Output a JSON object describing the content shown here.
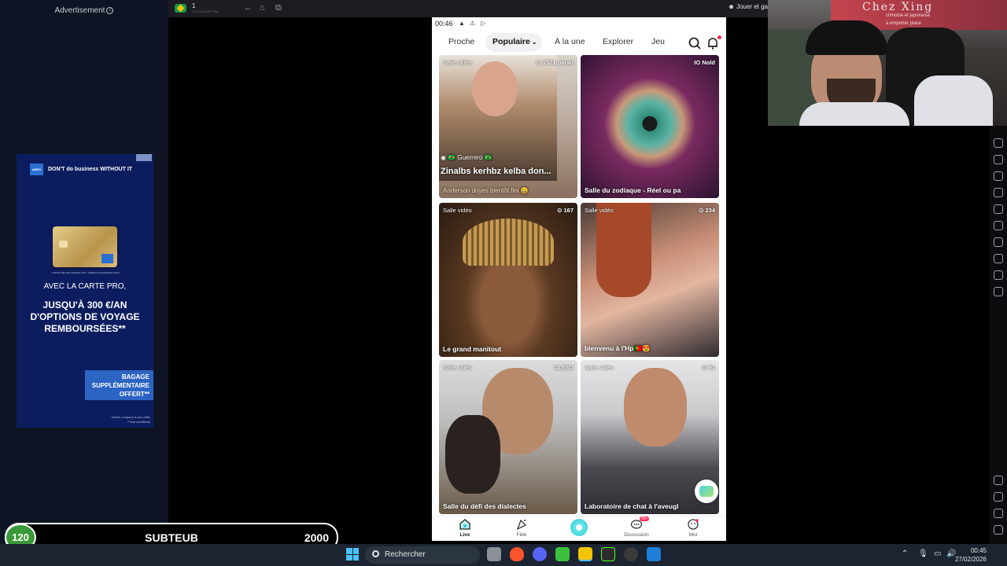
{
  "ad": {
    "label": "Advertisement",
    "brand_tagline": "DON'T do business WITHOUT IT",
    "card_fineprint": "CARTE PRO AIR FRANCE KLM - AMERICAN EXPRESS GOLD",
    "headline": "AVEC LA CARTE PRO,",
    "offer": "JUSQU'À 300 €/AN D'OPTIONS DE VOYAGE REMBOURSÉES**",
    "badge": "BAGAGE SUPPLÉMENTAIRE OFFERT**",
    "legal_1": "*Amex, toujours à vos côtés",
    "legal_2": "**Voir conditions"
  },
  "browser": {
    "tab_title": "1",
    "tab_subtitle": "4.22.110.1037.P44",
    "right_text": "Jouer et ga"
  },
  "webcam": {
    "sign_text": "Chez Xing",
    "sign_sub_1": "chinoise et japonaise",
    "sign_sub_2": "à emporter    place"
  },
  "phone": {
    "status_time": "00:46",
    "tabs": [
      {
        "label": "Proche",
        "active": false
      },
      {
        "label": "Populaire",
        "active": true
      },
      {
        "label": "À la une",
        "active": false
      },
      {
        "label": "Explorer",
        "active": false
      },
      {
        "label": "Jeu",
        "active": false
      }
    ],
    "cards": [
      {
        "badge": "Salle vidéo",
        "count": "1501 parad",
        "host": "🇧🇷 Guerrero 🇧🇷",
        "title": "Zinalbs kerhbz kelba don...",
        "caption": "Anderson doyes bientôt fini 😀"
      },
      {
        "badge": "",
        "count": "IO Nold",
        "caption": "Salle du zodiaque - Réel ou pa"
      },
      {
        "badge": "Salle vidéo",
        "count": "167",
        "caption": "Le grand manitout"
      },
      {
        "badge": "Salle vidéo",
        "count": "234",
        "caption": "bienvenu à l'Hp🇵🇹😍"
      },
      {
        "badge": "Salle vidéo",
        "count": "CL5SO",
        "caption": "Salle du défi des dialectes"
      },
      {
        "badge": "Salle vidéo",
        "count": "91",
        "caption": "Laboratoire de chat à l'aveugl"
      }
    ],
    "bottom_nav": [
      {
        "label": "Live",
        "active": true
      },
      {
        "label": "Fête",
        "active": false
      },
      {
        "label": "",
        "active": false
      },
      {
        "label": "Discussion",
        "active": false,
        "badge": "99+"
      },
      {
        "label": "Moi",
        "active": false
      }
    ]
  },
  "score": {
    "current": "120",
    "name": "SUBTEUB",
    "goal": "2000"
  },
  "taskbar": {
    "search_placeholder": "Rechercher",
    "time": "00:45",
    "date": "27/02/2026"
  },
  "colors": {
    "accent_teal": "#2cc9d6",
    "badge_red": "#ff2a55",
    "score_green": "#3a9a3a",
    "ad_blue": "#0b1d5e"
  }
}
